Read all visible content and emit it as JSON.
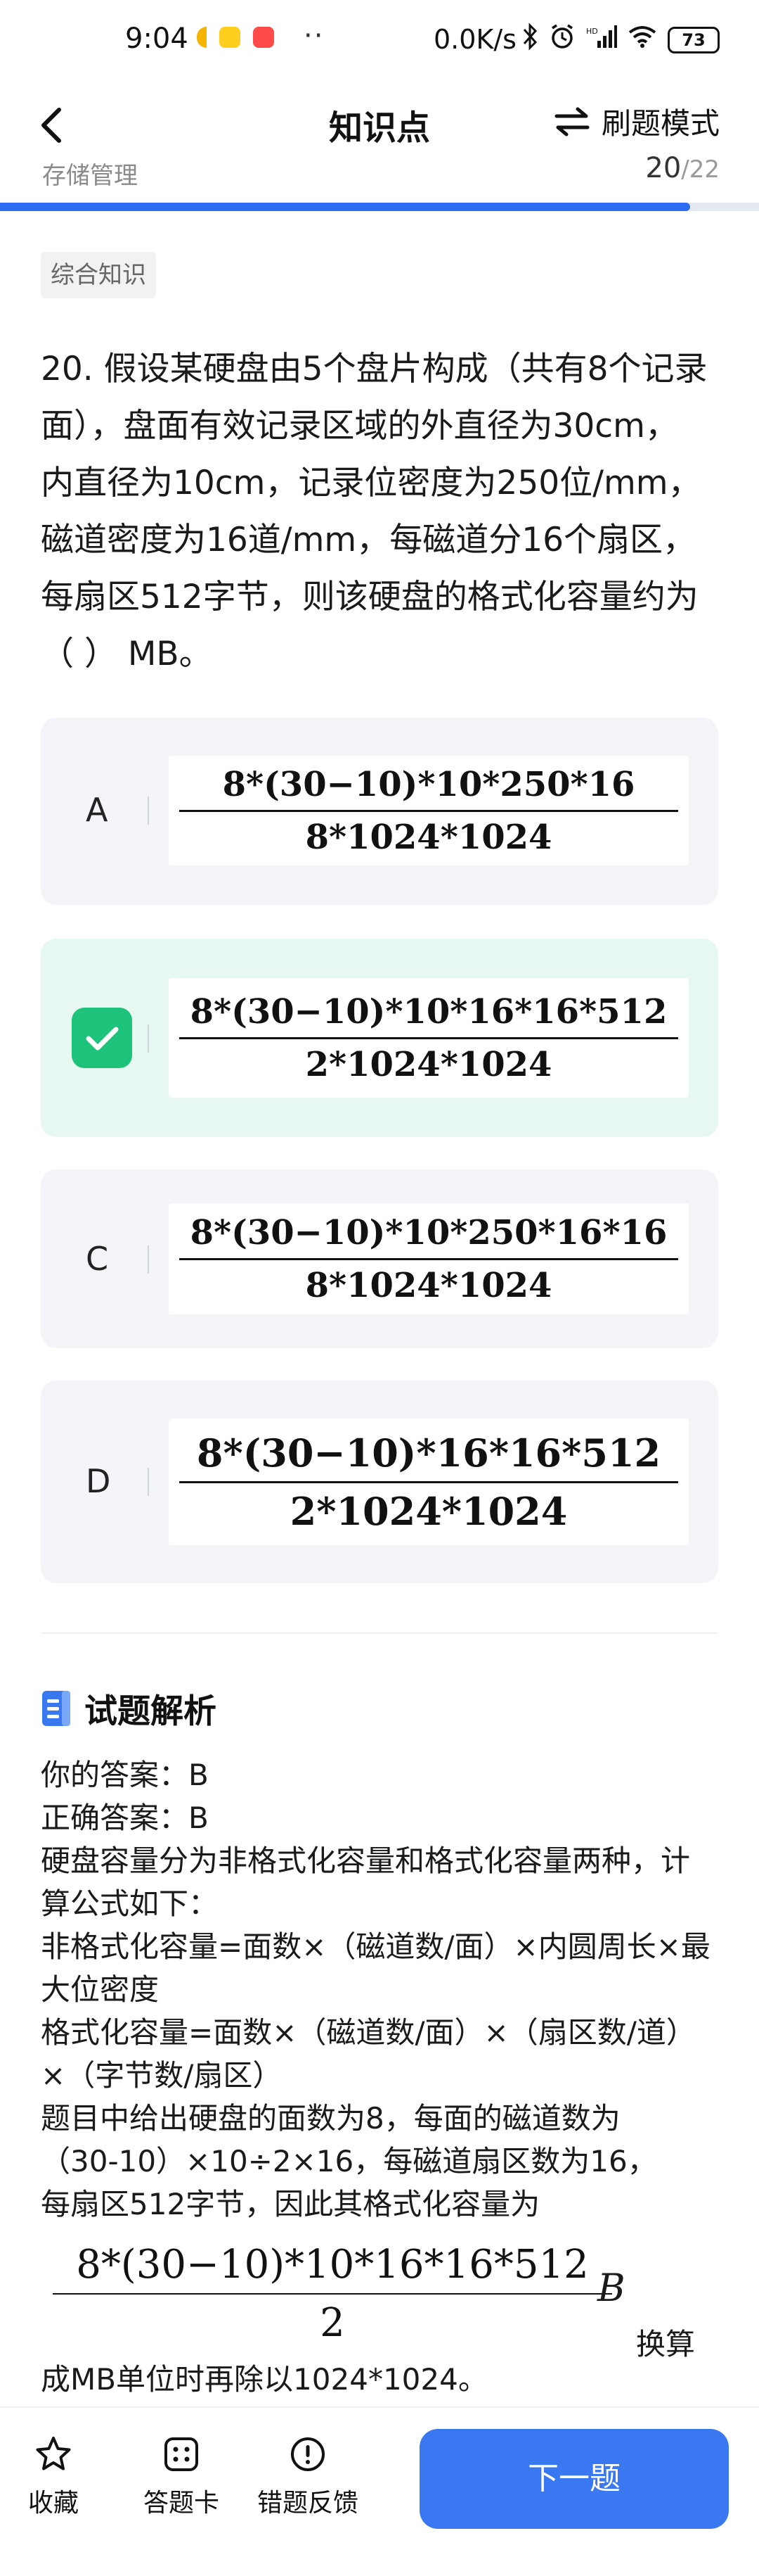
{
  "status_bar": {
    "time": "9:04",
    "more": "··",
    "network_speed": "0.0K/s",
    "battery": "73"
  },
  "header": {
    "title": "知识点",
    "mode_label": "刷题模式"
  },
  "progress": {
    "breadcrumb": "存储管理",
    "current": "20",
    "total": "/22",
    "fraction": 0.909,
    "color": "#2f6bf2"
  },
  "section_tag": "综合知识",
  "question": {
    "text": "20. 假设某硬盘由5个盘片构成（共有8个记录面），盘面有效记录区域的外直径为30cm， 内直径为10cm，记录位密度为250位/mm，磁道密度为16道/mm，每磁道分16个扇区，每扇区512字节，则该硬盘的格式化容量约为（ ） MB。"
  },
  "options": [
    {
      "letter": "A",
      "numerator": "8*(30−10)*10*250*16",
      "denominator": "8*1024*1024",
      "state": "normal"
    },
    {
      "letter": "B",
      "numerator": "8*(30−10)*10*16*16*512",
      "denominator": "2*1024*1024",
      "state": "correct"
    },
    {
      "letter": "C",
      "numerator": "8*(30−10)*10*250*16*16",
      "denominator": "8*1024*1024",
      "state": "normal"
    },
    {
      "letter": "D",
      "numerator": "8*(30−10)*16*16*512",
      "denominator": "2*1024*1024",
      "state": "normal"
    }
  ],
  "analysis": {
    "title": "试题解析",
    "your_answer": "你的答案：B",
    "correct_answer": "正确答案：B",
    "paragraphs": [
      "硬盘容量分为非格式化容量和格式化容量两种，计算公式如下：",
      "非格式化容量=面数×（磁道数/面）×内圆周长×最大位密度",
      "格式化容量=面数×（磁道数/面）×（扇区数/道）×（字节数/扇区）",
      "题目中给出硬盘的面数为8，每面的磁道数为（30-10）×10÷2×16，每磁道扇区数为16，每扇区512字节，因此其格式化容量为"
    ],
    "formula_numerator": "8*(30−10)*10*16*16*512",
    "formula_denominator": "2",
    "formula_unit": "B",
    "after_formula": "换算",
    "last_line": "成MB单位时再除以1024*1024。"
  },
  "bottom_bar": {
    "favorite_label": "收藏",
    "answer_card_label": "答题卡",
    "feedback_label": "错题反馈",
    "next_label": "下一题"
  },
  "colors": {
    "accent": "#3a78f2",
    "correct": "#1ec37b",
    "correct_bg": "#e6f8ef",
    "option_bg": "#f3f5f9"
  }
}
